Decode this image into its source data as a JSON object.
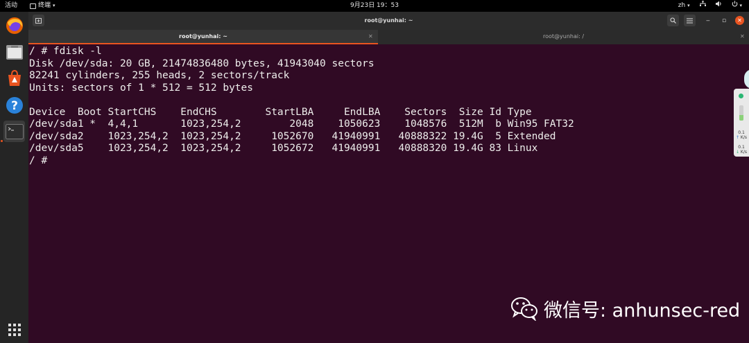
{
  "topbar": {
    "activities": "活动",
    "app_name": "终端",
    "clock": "9月23日  19：53",
    "lang": "zh"
  },
  "window": {
    "title": "root@yunhai: ~",
    "tabs": [
      {
        "label": "root@yunhai: ~",
        "active": true
      },
      {
        "label": "root@yunhai: /",
        "active": false
      }
    ]
  },
  "terminal": {
    "lines": [
      "/ # fdisk -l",
      "Disk /dev/sda: 20 GB, 21474836480 bytes, 41943040 sectors",
      "82241 cylinders, 255 heads, 2 sectors/track",
      "Units: sectors of 1 * 512 = 512 bytes",
      "",
      "Device  Boot StartCHS    EndCHS        StartLBA     EndLBA    Sectors  Size Id Type",
      "/dev/sda1 *  4,4,1       1023,254,2        2048    1050623    1048576  512M  b Win95 FAT32",
      "/dev/sda2    1023,254,2  1023,254,2     1052670   41940991   40888322 19.4G  5 Extended",
      "/dev/sda5    1023,254,2  1023,254,2     1052672   41940991   40888320 19.4G 83 Linux",
      "/ #"
    ]
  },
  "widget": {
    "upload_value": "0.1",
    "upload_unit": "K/s",
    "download_value": "0.1",
    "download_unit": "K/s"
  },
  "watermark": {
    "text": "微信号: anhunsec-red"
  },
  "colors": {
    "terminal_bg": "#300a24",
    "accent": "#e95420",
    "dock_bg": "#252525"
  },
  "dock": {
    "items": [
      "firefox-icon",
      "files-icon",
      "software-icon",
      "help-icon",
      "terminal-icon",
      "apps-grid-icon"
    ]
  }
}
